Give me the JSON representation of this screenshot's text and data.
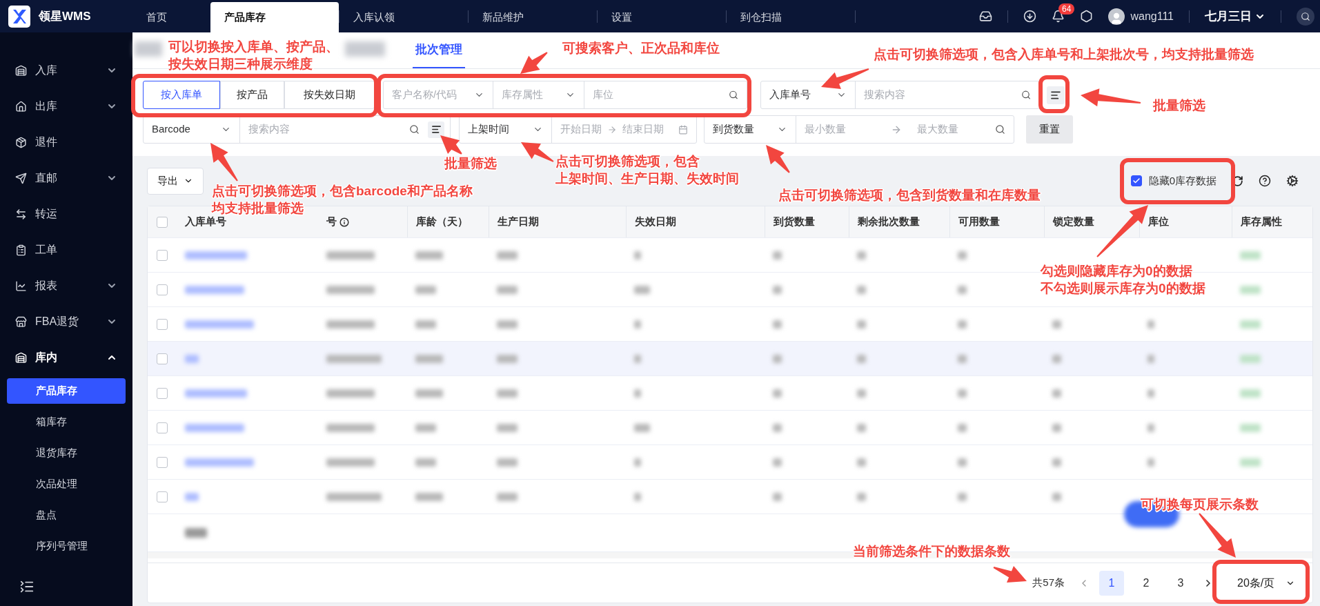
{
  "app": {
    "logo_text": "领星WMS"
  },
  "top_tabs": [
    {
      "label": "首页",
      "selected": false
    },
    {
      "label": "产品库存",
      "selected": true
    },
    {
      "label": "入库认领",
      "selected": false
    },
    {
      "label": "新品维护",
      "selected": false
    },
    {
      "label": "设置",
      "selected": false
    },
    {
      "label": "到仓扫描",
      "selected": false
    }
  ],
  "header": {
    "notification_count": "64",
    "username": "wang111",
    "date": "七月三日"
  },
  "sidebar": {
    "items": [
      {
        "label": "入库",
        "kind": "group",
        "expanded": false
      },
      {
        "label": "出库",
        "kind": "group",
        "expanded": false
      },
      {
        "label": "退件",
        "kind": "link"
      },
      {
        "label": "直邮",
        "kind": "group",
        "expanded": false
      },
      {
        "label": "转运",
        "kind": "link"
      },
      {
        "label": "工单",
        "kind": "link"
      },
      {
        "label": "报表",
        "kind": "group",
        "expanded": false
      },
      {
        "label": "FBA退货",
        "kind": "group",
        "expanded": false
      },
      {
        "label": "库内",
        "kind": "group",
        "expanded": true,
        "children": [
          {
            "label": "产品库存",
            "selected": true
          },
          {
            "label": "箱库存",
            "selected": false
          },
          {
            "label": "退货库存",
            "selected": false
          },
          {
            "label": "次品处理",
            "selected": false
          },
          {
            "label": "盘点",
            "selected": false
          },
          {
            "label": "序列号管理",
            "selected": false
          }
        ]
      }
    ]
  },
  "page_tabs": [
    {
      "label": "批次管理",
      "selected": true
    }
  ],
  "view_modes": [
    {
      "label": "按入库单",
      "selected": true
    },
    {
      "label": "按产品",
      "selected": false
    },
    {
      "label": "按失效日期",
      "selected": false
    }
  ],
  "filters": {
    "customer": {
      "placeholder": "客户名称/代码"
    },
    "stock_attribute": {
      "placeholder": "库存属性"
    },
    "location": {
      "placeholder": "库位"
    },
    "order_search": {
      "field": "入库单号",
      "placeholder": "搜索内容"
    },
    "barcode_search": {
      "field": "Barcode",
      "placeholder": "搜索内容"
    },
    "date_range": {
      "field": "上架时间",
      "start_placeholder": "开始日期",
      "end_placeholder": "结束日期"
    },
    "quantity_range": {
      "field": "到货数量",
      "min_placeholder": "最小数量",
      "max_placeholder": "最大数量"
    },
    "reset_button": "重置"
  },
  "toolbar": {
    "export_button": "导出",
    "hide_zero": {
      "label": "隐藏0库存数据",
      "checked": true
    }
  },
  "table": {
    "header_checked": false,
    "columns": [
      {
        "label": "入库单号",
        "info": false
      },
      {
        "label": "号",
        "info": true
      },
      {
        "label": "库龄（天）",
        "info": false
      },
      {
        "label": "生产日期",
        "info": false
      },
      {
        "label": "失效日期",
        "info": false
      },
      {
        "label": "到货数量",
        "info": false
      },
      {
        "label": "剩余批次数量",
        "info": false
      },
      {
        "label": "可用数量",
        "info": false
      },
      {
        "label": "锁定数量",
        "info": false
      },
      {
        "label": "库位",
        "info": false
      },
      {
        "label": "库存属性",
        "info": false
      }
    ],
    "rows": [
      {
        "checked": false,
        "highlighted": false
      },
      {
        "checked": false,
        "highlighted": false
      },
      {
        "checked": false,
        "highlighted": false
      },
      {
        "checked": false,
        "highlighted": true
      },
      {
        "checked": false,
        "highlighted": false
      },
      {
        "checked": false,
        "highlighted": false
      },
      {
        "checked": false,
        "highlighted": false
      },
      {
        "checked": false,
        "highlighted": false
      }
    ]
  },
  "pagination": {
    "total": "共57条",
    "pages": [
      {
        "label": "1",
        "selected": true
      },
      {
        "label": "2",
        "selected": false
      },
      {
        "label": "3",
        "selected": false
      }
    ],
    "page_size": "20条/页"
  },
  "annotations": [
    {
      "lines": [
        "可以切换按入库单、按产品、",
        "按失效日期三种展示维度"
      ]
    },
    {
      "lines": [
        "可搜索客户、正次品和库位"
      ]
    },
    {
      "lines": [
        "点击可切换筛选项，包含入库单号和上架批次号，均支持批量筛选"
      ]
    },
    {
      "lines": [
        "批量筛选"
      ]
    },
    {
      "lines": [
        "批量筛选"
      ]
    },
    {
      "lines": [
        "点击可切换筛选项，包含",
        "上架时间、生产日期、失效时间"
      ]
    },
    {
      "lines": [
        "点击可切换筛选项，包含barcode和产品名称",
        "均支持批量筛选"
      ]
    },
    {
      "lines": [
        "点击可切换筛选项，包含到货数量和在库数量"
      ]
    },
    {
      "lines": [
        "勾选则隐藏库存为0的数据",
        "不勾选则展示库存为0的数据"
      ]
    },
    {
      "lines": [
        "可切换每页展示条数"
      ]
    },
    {
      "lines": [
        "当前筛选条件下的数据条数"
      ]
    }
  ]
}
